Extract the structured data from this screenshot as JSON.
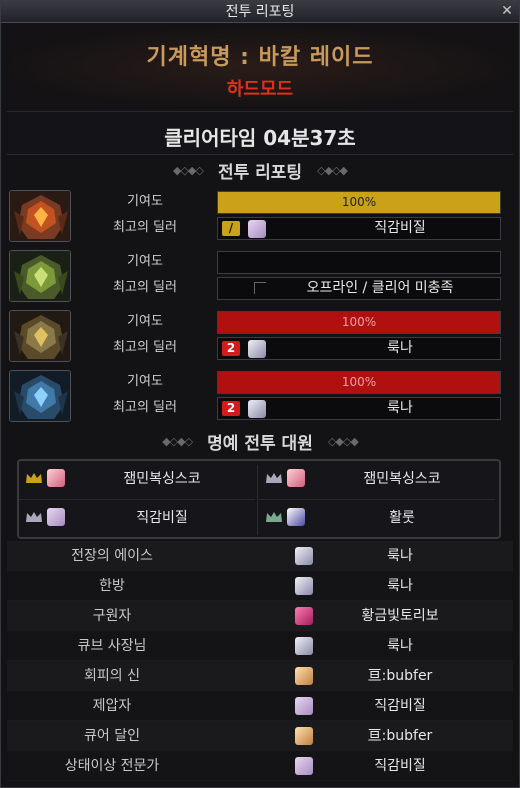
{
  "window": {
    "title": "전투 리포팅",
    "close_glyph": "✕"
  },
  "banner": {
    "raid_name": "기계혁명 : 바칼 레이드",
    "mode": "하드모드"
  },
  "clear_time": "클리어타임  04분37초",
  "report_section": {
    "title": "전투 리포팅"
  },
  "bosses": [
    {
      "contribution_label": "기여도",
      "contribution_value": 1.0,
      "contribution_text": "100%",
      "bar_color": "#c9a21a",
      "dealer_label": "최고의 딜러",
      "dealer_name": "직감비질",
      "badge": "/",
      "badge_color": "#c9a21a"
    },
    {
      "contribution_label": "기여도",
      "contribution_value": 0,
      "contribution_text": "",
      "dealer_label": "최고의 딜러",
      "dealer_name": "오프라인 / 클리어 미충족",
      "badge": "",
      "badge_color": ""
    },
    {
      "contribution_label": "기여도",
      "contribution_value": 1.0,
      "contribution_text": "100%",
      "bar_color": "#b01010",
      "dealer_label": "최고의 딜러",
      "dealer_name": "룩나",
      "badge": "2",
      "badge_color": "#d21b1b"
    },
    {
      "contribution_label": "기여도",
      "contribution_value": 1.0,
      "contribution_text": "100%",
      "bar_color": "#b01010",
      "dealer_label": "최고의 딜러",
      "dealer_name": "룩나",
      "badge": "2",
      "badge_color": "#d21b1b"
    }
  ],
  "honor_section": {
    "title": "명예 전투 대원",
    "members": [
      {
        "name": "잼민복싱스코"
      },
      {
        "name": "잼민복싱스코"
      },
      {
        "name": "직감비질"
      },
      {
        "name": "활룻"
      }
    ]
  },
  "awards": [
    {
      "title": "전장의 에이스",
      "name": "룩나"
    },
    {
      "title": "한방",
      "name": "룩나"
    },
    {
      "title": "구원자",
      "name": "황금빛토리보"
    },
    {
      "title": "큐브 사장님",
      "name": "룩나"
    },
    {
      "title": "회피의 신",
      "name": "亘:bubfer"
    },
    {
      "title": "제압자",
      "name": "직감비질"
    },
    {
      "title": "큐어 달인",
      "name": "亘:bubfer"
    },
    {
      "title": "상태이상 전문가",
      "name": "직감비질"
    }
  ]
}
